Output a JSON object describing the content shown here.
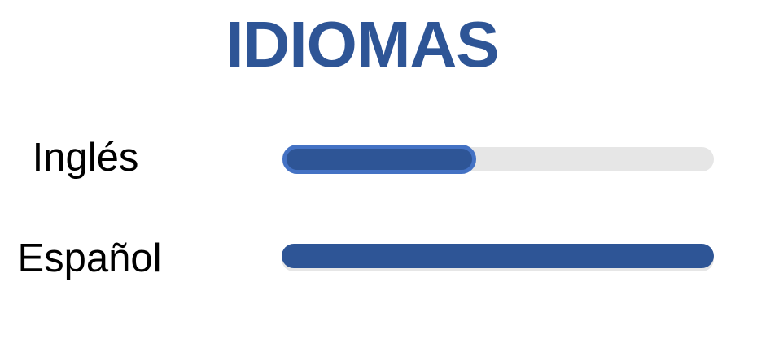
{
  "title": "IDIOMAS",
  "colors": {
    "title": "#2e5596",
    "fill": "#2e5596",
    "fill_outline": "#4472c4",
    "track": "#e6e6e6",
    "label": "#000000"
  },
  "skills": [
    {
      "label": "Inglés",
      "level_percent": 45,
      "selected": true
    },
    {
      "label": "Español",
      "level_percent": 100,
      "selected": false
    }
  ]
}
